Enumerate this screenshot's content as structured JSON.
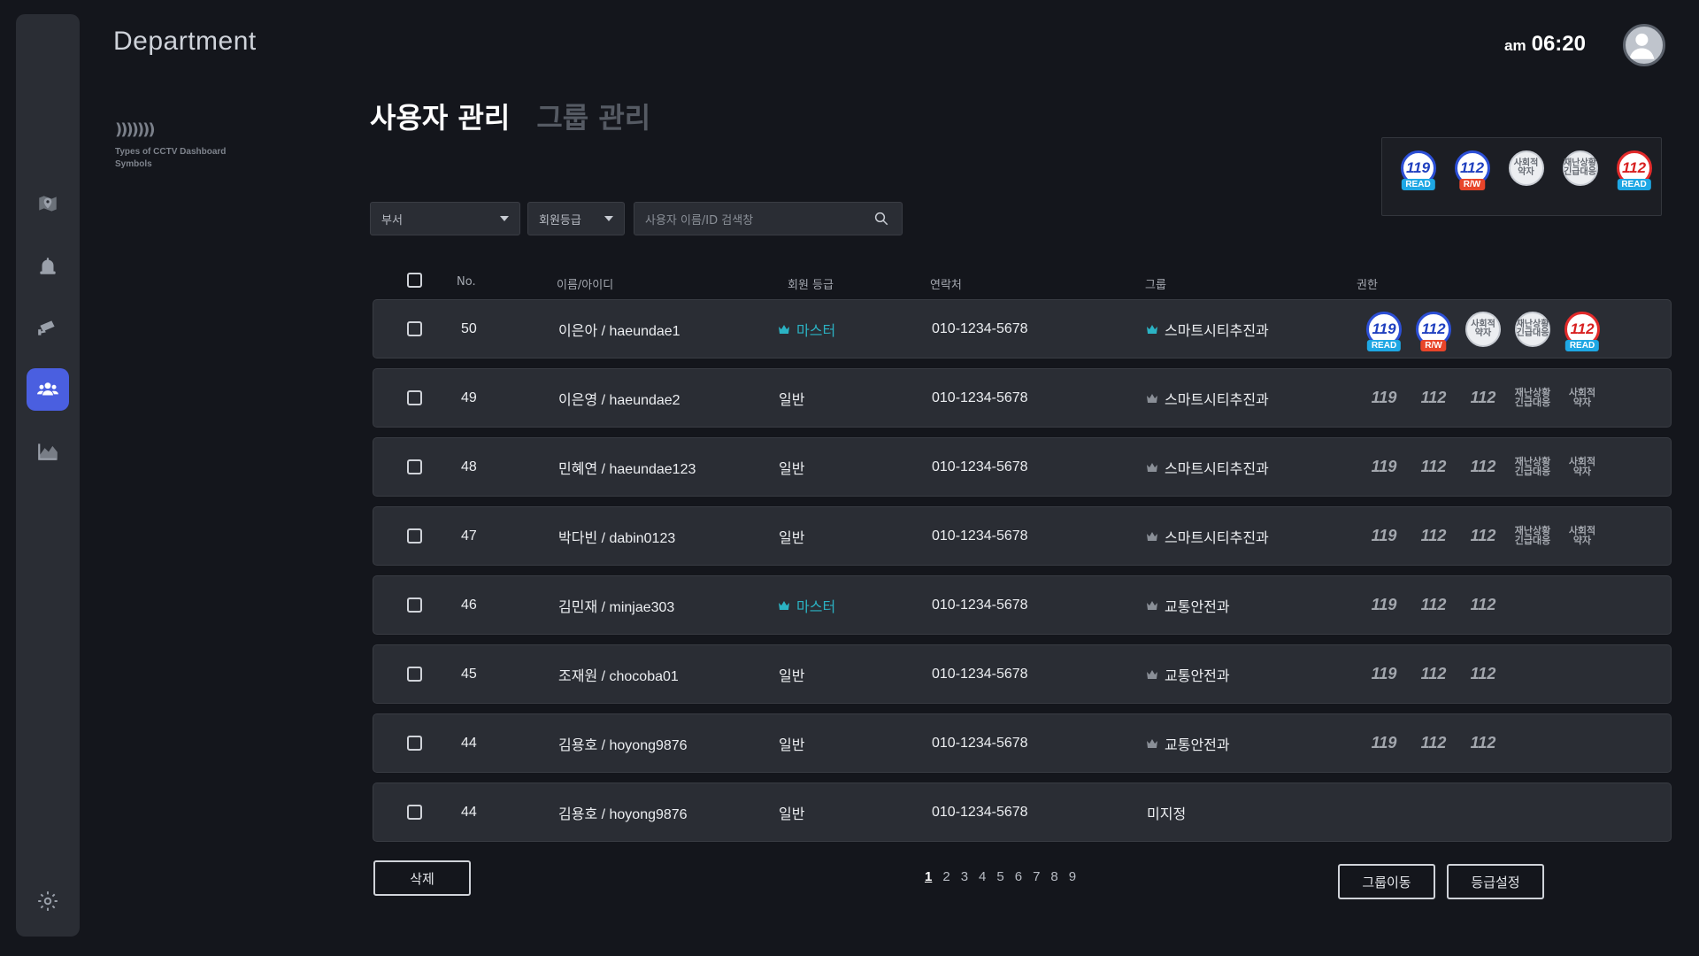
{
  "brand": "Department",
  "legend_text": [
    "Types of CCTV Dashboard",
    "Symbols"
  ],
  "clock": {
    "ampm": "am",
    "time": "06:20"
  },
  "tabs": [
    {
      "label": "사용자 관리",
      "active": true
    },
    {
      "label": "그룹 관리",
      "active": false
    }
  ],
  "top_permissions": [
    {
      "icon": "119-icon",
      "text": "119",
      "style": "blue",
      "badge": "READ"
    },
    {
      "icon": "112-icon",
      "text": "112",
      "style": "blue",
      "badge": "R/W"
    },
    {
      "icon": "social-vulnerable-icon",
      "text": "사회적\n약자",
      "style": "plain",
      "badge": ""
    },
    {
      "icon": "emergency-icon",
      "text": "재난상황\n긴급대응",
      "style": "plain",
      "badge": ""
    },
    {
      "icon": "112-red-icon",
      "text": "112",
      "style": "red",
      "badge": "READ"
    }
  ],
  "filters": {
    "dept": "부서",
    "grade": "회원등급",
    "search_placeholder": "사용자 이름/ID 검색창"
  },
  "columns": {
    "no": "No.",
    "name": "이름/아이디",
    "grade": "회원 등급",
    "phone": "연락처",
    "group": "그룹",
    "perm": "권한"
  },
  "rows": [
    {
      "no": "50",
      "name": "이은아 / haeundae1",
      "grade": "마스터",
      "master": true,
      "phone": "010-1234-5678",
      "group": "스마트시티추진과",
      "group_crown": true,
      "group_crown_color": "#2bb3c4",
      "perm_mode": "active",
      "perms": 5
    },
    {
      "no": "49",
      "name": "이은영 / haeundae2",
      "grade": "일반",
      "master": false,
      "phone": "010-1234-5678",
      "group": "스마트시티추진과",
      "group_crown": true,
      "group_crown_color": "#8a8f97",
      "perm_mode": "ghost",
      "perms": 5
    },
    {
      "no": "48",
      "name": "민혜연 / haeundae123",
      "grade": "일반",
      "master": false,
      "phone": "010-1234-5678",
      "group": "스마트시티추진과",
      "group_crown": true,
      "group_crown_color": "#8a8f97",
      "perm_mode": "ghost",
      "perms": 5
    },
    {
      "no": "47",
      "name": "박다빈 / dabin0123",
      "grade": "일반",
      "master": false,
      "phone": "010-1234-5678",
      "group": "스마트시티추진과",
      "group_crown": true,
      "group_crown_color": "#8a8f97",
      "perm_mode": "ghost",
      "perms": 5
    },
    {
      "no": "46",
      "name": "김민재 / minjae303",
      "grade": "마스터",
      "master": true,
      "phone": "010-1234-5678",
      "group": "교통안전과",
      "group_crown": true,
      "group_crown_color": "#8a8f97",
      "perm_mode": "ghost",
      "perms": 3
    },
    {
      "no": "45",
      "name": "조재원 / chocoba01",
      "grade": "일반",
      "master": false,
      "phone": "010-1234-5678",
      "group": "교통안전과",
      "group_crown": true,
      "group_crown_color": "#8a8f97",
      "perm_mode": "ghost",
      "perms": 3
    },
    {
      "no": "44",
      "name": "김용호 / hoyong9876",
      "grade": "일반",
      "master": false,
      "phone": "010-1234-5678",
      "group": "교통안전과",
      "group_crown": true,
      "group_crown_color": "#8a8f97",
      "perm_mode": "ghost",
      "perms": 3
    },
    {
      "no": "44",
      "name": "김용호 / hoyong9876",
      "grade": "일반",
      "master": false,
      "phone": "010-1234-5678",
      "group": "미지정",
      "group_crown": false,
      "group_crown_color": "",
      "perm_mode": "none",
      "perms": 0
    }
  ],
  "ghost_labels": [
    "119",
    "112",
    "112",
    "재난상황\n긴급대응",
    "사회적\n약자"
  ],
  "buttons": {
    "delete": "삭제",
    "move_group": "그룹이동",
    "set_grade": "등급설정"
  },
  "pages": [
    "1",
    "2",
    "3",
    "4",
    "5",
    "6",
    "7",
    "8",
    "9"
  ],
  "current_page": "1",
  "colors": {
    "accent": "#4a5fe0",
    "master": "#2bb3c4",
    "read": "#1ea7e4",
    "rw": "#e8452a"
  }
}
